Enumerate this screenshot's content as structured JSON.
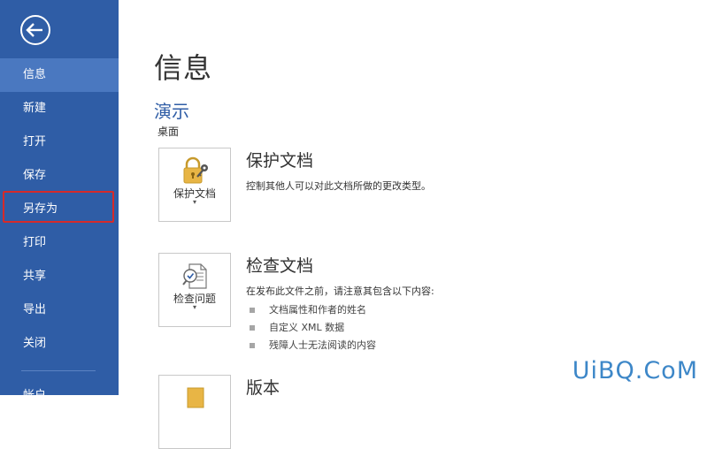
{
  "sidebar": {
    "items": [
      {
        "label": "信息",
        "active": true
      },
      {
        "label": "新建"
      },
      {
        "label": "打开"
      },
      {
        "label": "保存"
      },
      {
        "label": "另存为",
        "highlighted": true
      },
      {
        "label": "打印"
      },
      {
        "label": "共享"
      },
      {
        "label": "导出"
      },
      {
        "label": "关闭"
      }
    ],
    "account_label": "帐户"
  },
  "main": {
    "title": "信息",
    "doc_name": "演示",
    "doc_path": "桌面",
    "sections": [
      {
        "tile_label": "保护文档",
        "title": "保护文档",
        "desc": "控制其他人可以对此文档所做的更改类型。",
        "items": []
      },
      {
        "tile_label": "检查问题",
        "title": "检查文档",
        "desc": "在发布此文件之前，请注意其包含以下内容:",
        "items": [
          "文档属性和作者的姓名",
          "自定义 XML 数据",
          "残障人士无法阅读的内容"
        ]
      },
      {
        "tile_label": "",
        "title": "版本",
        "desc": "",
        "items": []
      }
    ]
  },
  "watermark": "UiBQ.CoM",
  "colors": {
    "sidebar_bg": "#2f5da6",
    "sidebar_active": "#4a78c0",
    "highlight_border": "#d62a2a",
    "accent": "#2f5da6"
  }
}
